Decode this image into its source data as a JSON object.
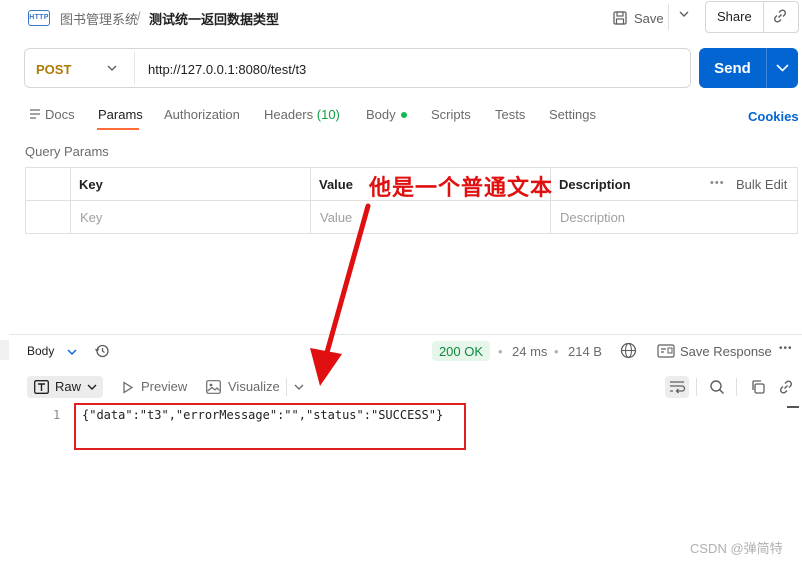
{
  "header": {
    "app_icon_text": "HTTP",
    "breadcrumb_parent": "图书管理系统",
    "breadcrumb_sep": "/",
    "breadcrumb_current": "测试统一返回数据类型",
    "save_label": "Save",
    "share_label": "Share"
  },
  "request": {
    "method": "POST",
    "url": "http://127.0.0.1:8080/test/t3",
    "send_label": "Send"
  },
  "tabs": {
    "docs": "Docs",
    "params": "Params",
    "authorization": "Authorization",
    "headers": "Headers",
    "headers_count": "(10)",
    "body": "Body",
    "scripts": "Scripts",
    "tests": "Tests",
    "settings": "Settings",
    "cookies": "Cookies"
  },
  "query_params": {
    "title": "Query Params",
    "columns": [
      "Key",
      "Value",
      "Description"
    ],
    "placeholders": [
      "Key",
      "Value",
      "Description"
    ],
    "bulk_edit": "Bulk Edit"
  },
  "response": {
    "body_label": "Body",
    "status": "200 OK",
    "time": "24 ms",
    "size": "214 B",
    "save_response": "Save Response",
    "view_raw": "Raw",
    "view_preview": "Preview",
    "view_visualize": "Visualize",
    "line_number": "1",
    "code": "{\"data\":\"t3\",\"errorMessage\":\"\",\"status\":\"SUCCESS\"}"
  },
  "annotation_text": "他是一个普通文本",
  "watermark": "CSDN @弹简特",
  "colors": {
    "primary": "#0265d2",
    "method_post": "#ad7a03",
    "active_tab_underline": "#ff6c37",
    "annotation_red": "#e01010",
    "status_ok_bg": "#e6f6ea"
  }
}
